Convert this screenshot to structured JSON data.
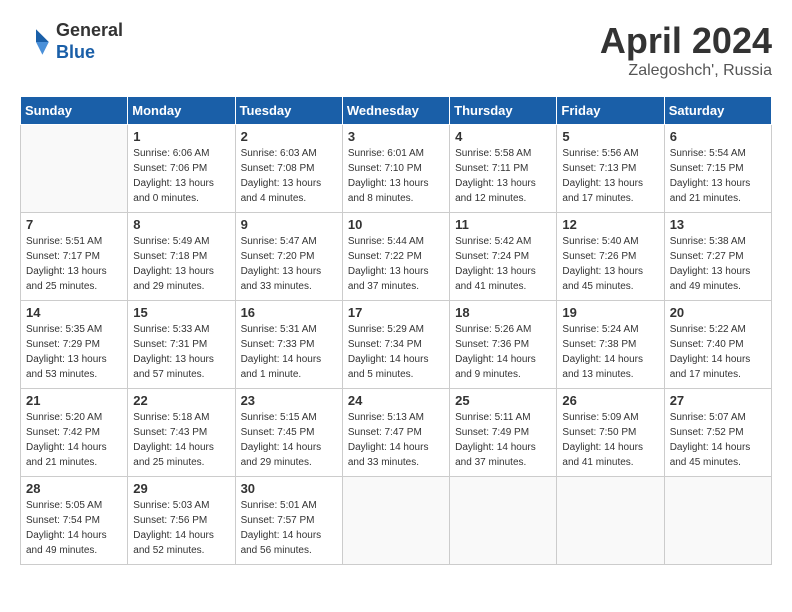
{
  "header": {
    "logo_general": "General",
    "logo_blue": "Blue",
    "title": "April 2024",
    "location": "Zalegoshch', Russia"
  },
  "weekdays": [
    "Sunday",
    "Monday",
    "Tuesday",
    "Wednesday",
    "Thursday",
    "Friday",
    "Saturday"
  ],
  "weeks": [
    [
      {
        "day": "",
        "sunrise": "",
        "sunset": "",
        "daylight": ""
      },
      {
        "day": "1",
        "sunrise": "Sunrise: 6:06 AM",
        "sunset": "Sunset: 7:06 PM",
        "daylight": "Daylight: 13 hours and 0 minutes."
      },
      {
        "day": "2",
        "sunrise": "Sunrise: 6:03 AM",
        "sunset": "Sunset: 7:08 PM",
        "daylight": "Daylight: 13 hours and 4 minutes."
      },
      {
        "day": "3",
        "sunrise": "Sunrise: 6:01 AM",
        "sunset": "Sunset: 7:10 PM",
        "daylight": "Daylight: 13 hours and 8 minutes."
      },
      {
        "day": "4",
        "sunrise": "Sunrise: 5:58 AM",
        "sunset": "Sunset: 7:11 PM",
        "daylight": "Daylight: 13 hours and 12 minutes."
      },
      {
        "day": "5",
        "sunrise": "Sunrise: 5:56 AM",
        "sunset": "Sunset: 7:13 PM",
        "daylight": "Daylight: 13 hours and 17 minutes."
      },
      {
        "day": "6",
        "sunrise": "Sunrise: 5:54 AM",
        "sunset": "Sunset: 7:15 PM",
        "daylight": "Daylight: 13 hours and 21 minutes."
      }
    ],
    [
      {
        "day": "7",
        "sunrise": "Sunrise: 5:51 AM",
        "sunset": "Sunset: 7:17 PM",
        "daylight": "Daylight: 13 hours and 25 minutes."
      },
      {
        "day": "8",
        "sunrise": "Sunrise: 5:49 AM",
        "sunset": "Sunset: 7:18 PM",
        "daylight": "Daylight: 13 hours and 29 minutes."
      },
      {
        "day": "9",
        "sunrise": "Sunrise: 5:47 AM",
        "sunset": "Sunset: 7:20 PM",
        "daylight": "Daylight: 13 hours and 33 minutes."
      },
      {
        "day": "10",
        "sunrise": "Sunrise: 5:44 AM",
        "sunset": "Sunset: 7:22 PM",
        "daylight": "Daylight: 13 hours and 37 minutes."
      },
      {
        "day": "11",
        "sunrise": "Sunrise: 5:42 AM",
        "sunset": "Sunset: 7:24 PM",
        "daylight": "Daylight: 13 hours and 41 minutes."
      },
      {
        "day": "12",
        "sunrise": "Sunrise: 5:40 AM",
        "sunset": "Sunset: 7:26 PM",
        "daylight": "Daylight: 13 hours and 45 minutes."
      },
      {
        "day": "13",
        "sunrise": "Sunrise: 5:38 AM",
        "sunset": "Sunset: 7:27 PM",
        "daylight": "Daylight: 13 hours and 49 minutes."
      }
    ],
    [
      {
        "day": "14",
        "sunrise": "Sunrise: 5:35 AM",
        "sunset": "Sunset: 7:29 PM",
        "daylight": "Daylight: 13 hours and 53 minutes."
      },
      {
        "day": "15",
        "sunrise": "Sunrise: 5:33 AM",
        "sunset": "Sunset: 7:31 PM",
        "daylight": "Daylight: 13 hours and 57 minutes."
      },
      {
        "day": "16",
        "sunrise": "Sunrise: 5:31 AM",
        "sunset": "Sunset: 7:33 PM",
        "daylight": "Daylight: 14 hours and 1 minute."
      },
      {
        "day": "17",
        "sunrise": "Sunrise: 5:29 AM",
        "sunset": "Sunset: 7:34 PM",
        "daylight": "Daylight: 14 hours and 5 minutes."
      },
      {
        "day": "18",
        "sunrise": "Sunrise: 5:26 AM",
        "sunset": "Sunset: 7:36 PM",
        "daylight": "Daylight: 14 hours and 9 minutes."
      },
      {
        "day": "19",
        "sunrise": "Sunrise: 5:24 AM",
        "sunset": "Sunset: 7:38 PM",
        "daylight": "Daylight: 14 hours and 13 minutes."
      },
      {
        "day": "20",
        "sunrise": "Sunrise: 5:22 AM",
        "sunset": "Sunset: 7:40 PM",
        "daylight": "Daylight: 14 hours and 17 minutes."
      }
    ],
    [
      {
        "day": "21",
        "sunrise": "Sunrise: 5:20 AM",
        "sunset": "Sunset: 7:42 PM",
        "daylight": "Daylight: 14 hours and 21 minutes."
      },
      {
        "day": "22",
        "sunrise": "Sunrise: 5:18 AM",
        "sunset": "Sunset: 7:43 PM",
        "daylight": "Daylight: 14 hours and 25 minutes."
      },
      {
        "day": "23",
        "sunrise": "Sunrise: 5:15 AM",
        "sunset": "Sunset: 7:45 PM",
        "daylight": "Daylight: 14 hours and 29 minutes."
      },
      {
        "day": "24",
        "sunrise": "Sunrise: 5:13 AM",
        "sunset": "Sunset: 7:47 PM",
        "daylight": "Daylight: 14 hours and 33 minutes."
      },
      {
        "day": "25",
        "sunrise": "Sunrise: 5:11 AM",
        "sunset": "Sunset: 7:49 PM",
        "daylight": "Daylight: 14 hours and 37 minutes."
      },
      {
        "day": "26",
        "sunrise": "Sunrise: 5:09 AM",
        "sunset": "Sunset: 7:50 PM",
        "daylight": "Daylight: 14 hours and 41 minutes."
      },
      {
        "day": "27",
        "sunrise": "Sunrise: 5:07 AM",
        "sunset": "Sunset: 7:52 PM",
        "daylight": "Daylight: 14 hours and 45 minutes."
      }
    ],
    [
      {
        "day": "28",
        "sunrise": "Sunrise: 5:05 AM",
        "sunset": "Sunset: 7:54 PM",
        "daylight": "Daylight: 14 hours and 49 minutes."
      },
      {
        "day": "29",
        "sunrise": "Sunrise: 5:03 AM",
        "sunset": "Sunset: 7:56 PM",
        "daylight": "Daylight: 14 hours and 52 minutes."
      },
      {
        "day": "30",
        "sunrise": "Sunrise: 5:01 AM",
        "sunset": "Sunset: 7:57 PM",
        "daylight": "Daylight: 14 hours and 56 minutes."
      },
      {
        "day": "",
        "sunrise": "",
        "sunset": "",
        "daylight": ""
      },
      {
        "day": "",
        "sunrise": "",
        "sunset": "",
        "daylight": ""
      },
      {
        "day": "",
        "sunrise": "",
        "sunset": "",
        "daylight": ""
      },
      {
        "day": "",
        "sunrise": "",
        "sunset": "",
        "daylight": ""
      }
    ]
  ]
}
